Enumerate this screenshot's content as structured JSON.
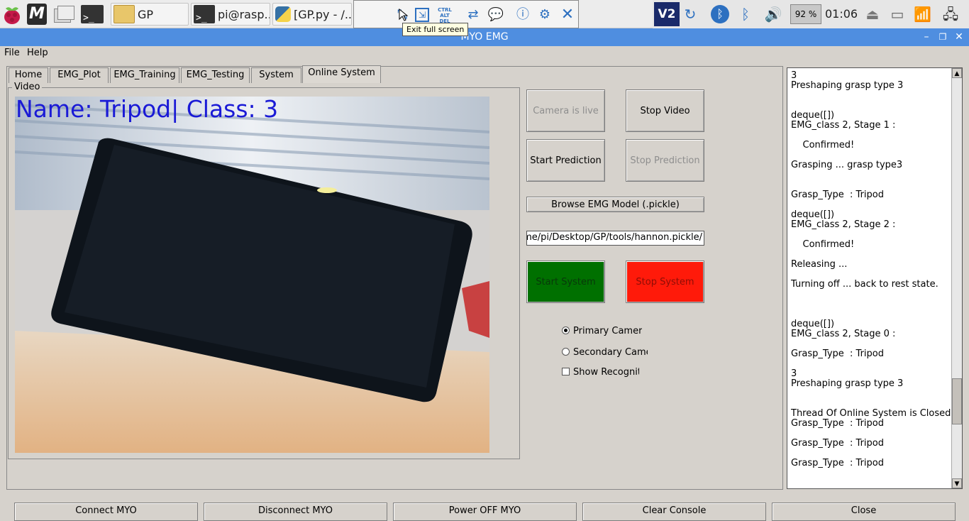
{
  "taskbar": {
    "mathematica_glyph": "M",
    "windows": [
      {
        "label": "GP"
      },
      {
        "label": "pi@rasp..."
      },
      {
        "label": "[GP.py - /..."
      },
      {
        "label": "M"
      }
    ],
    "battery": "92 %",
    "clock": "01:06",
    "vnc_glyph": "V2",
    "ctrl_alt_del_glyph": "CTRL ALT DEL"
  },
  "tooltip": "Exit full screen",
  "window": {
    "title": "MYO EMG"
  },
  "menubar": {
    "file": "File",
    "help": "Help"
  },
  "tabs": [
    {
      "label": "Home"
    },
    {
      "label": "EMG_Plot"
    },
    {
      "label": "EMG_Training"
    },
    {
      "label": "EMG_Testing"
    },
    {
      "label": "System"
    },
    {
      "label": "Online System"
    }
  ],
  "video": {
    "group_label": "Video",
    "overlay_text": "Name: Tripod| Class: 3"
  },
  "controls": {
    "camera_live": "Camera is live",
    "stop_video": "Stop Video",
    "start_prediction": "Start Prediction",
    "stop_prediction": "Stop Prediction",
    "browse_model": "Browse EMG Model (.pickle)",
    "model_path": "/home/pi/Desktop/GP/tools/hannon.pickle",
    "start_system": "Start System",
    "stop_system": "Stop System",
    "primary_camera": "Primary Camera",
    "secondary_camera": "Secondary Camera",
    "show_recognition": "Show Recognition",
    "primary_selected": true,
    "show_recognition_checked": false
  },
  "colors": {
    "start_system": "#007000",
    "stop_system": "#ff1a0a",
    "title_bar": "#4f8ee0",
    "overlay_text": "#1a1ad6"
  },
  "console": {
    "text": "3\nPreshaping grasp type 3\n\n\ndeque([])\nEMG_class 2, Stage 1 :\n\n    Confirmed!\n\nGrasping ... grasp type3\n\n\nGrasp_Type  : Tripod\n\ndeque([])\nEMG_class 2, Stage 2 :\n\n    Confirmed!\n\nReleasing ...\n\nTurning off ... back to rest state.\n\n\n\ndeque([])\nEMG_class 2, Stage 0 :\n\nGrasp_Type  : Tripod\n\n3\nPreshaping grasp type 3\n\n\nThread Of Online System is Closed\nGrasp_Type  : Tripod\n\nGrasp_Type  : Tripod\n\nGrasp_Type  : Tripod",
    "scroll_position": 0.85
  },
  "bottom_buttons": [
    {
      "label": "Connect MYO"
    },
    {
      "label": "Disconnect MYO"
    },
    {
      "label": "Power OFF MYO"
    },
    {
      "label": "Clear Console"
    },
    {
      "label": "Close"
    }
  ]
}
